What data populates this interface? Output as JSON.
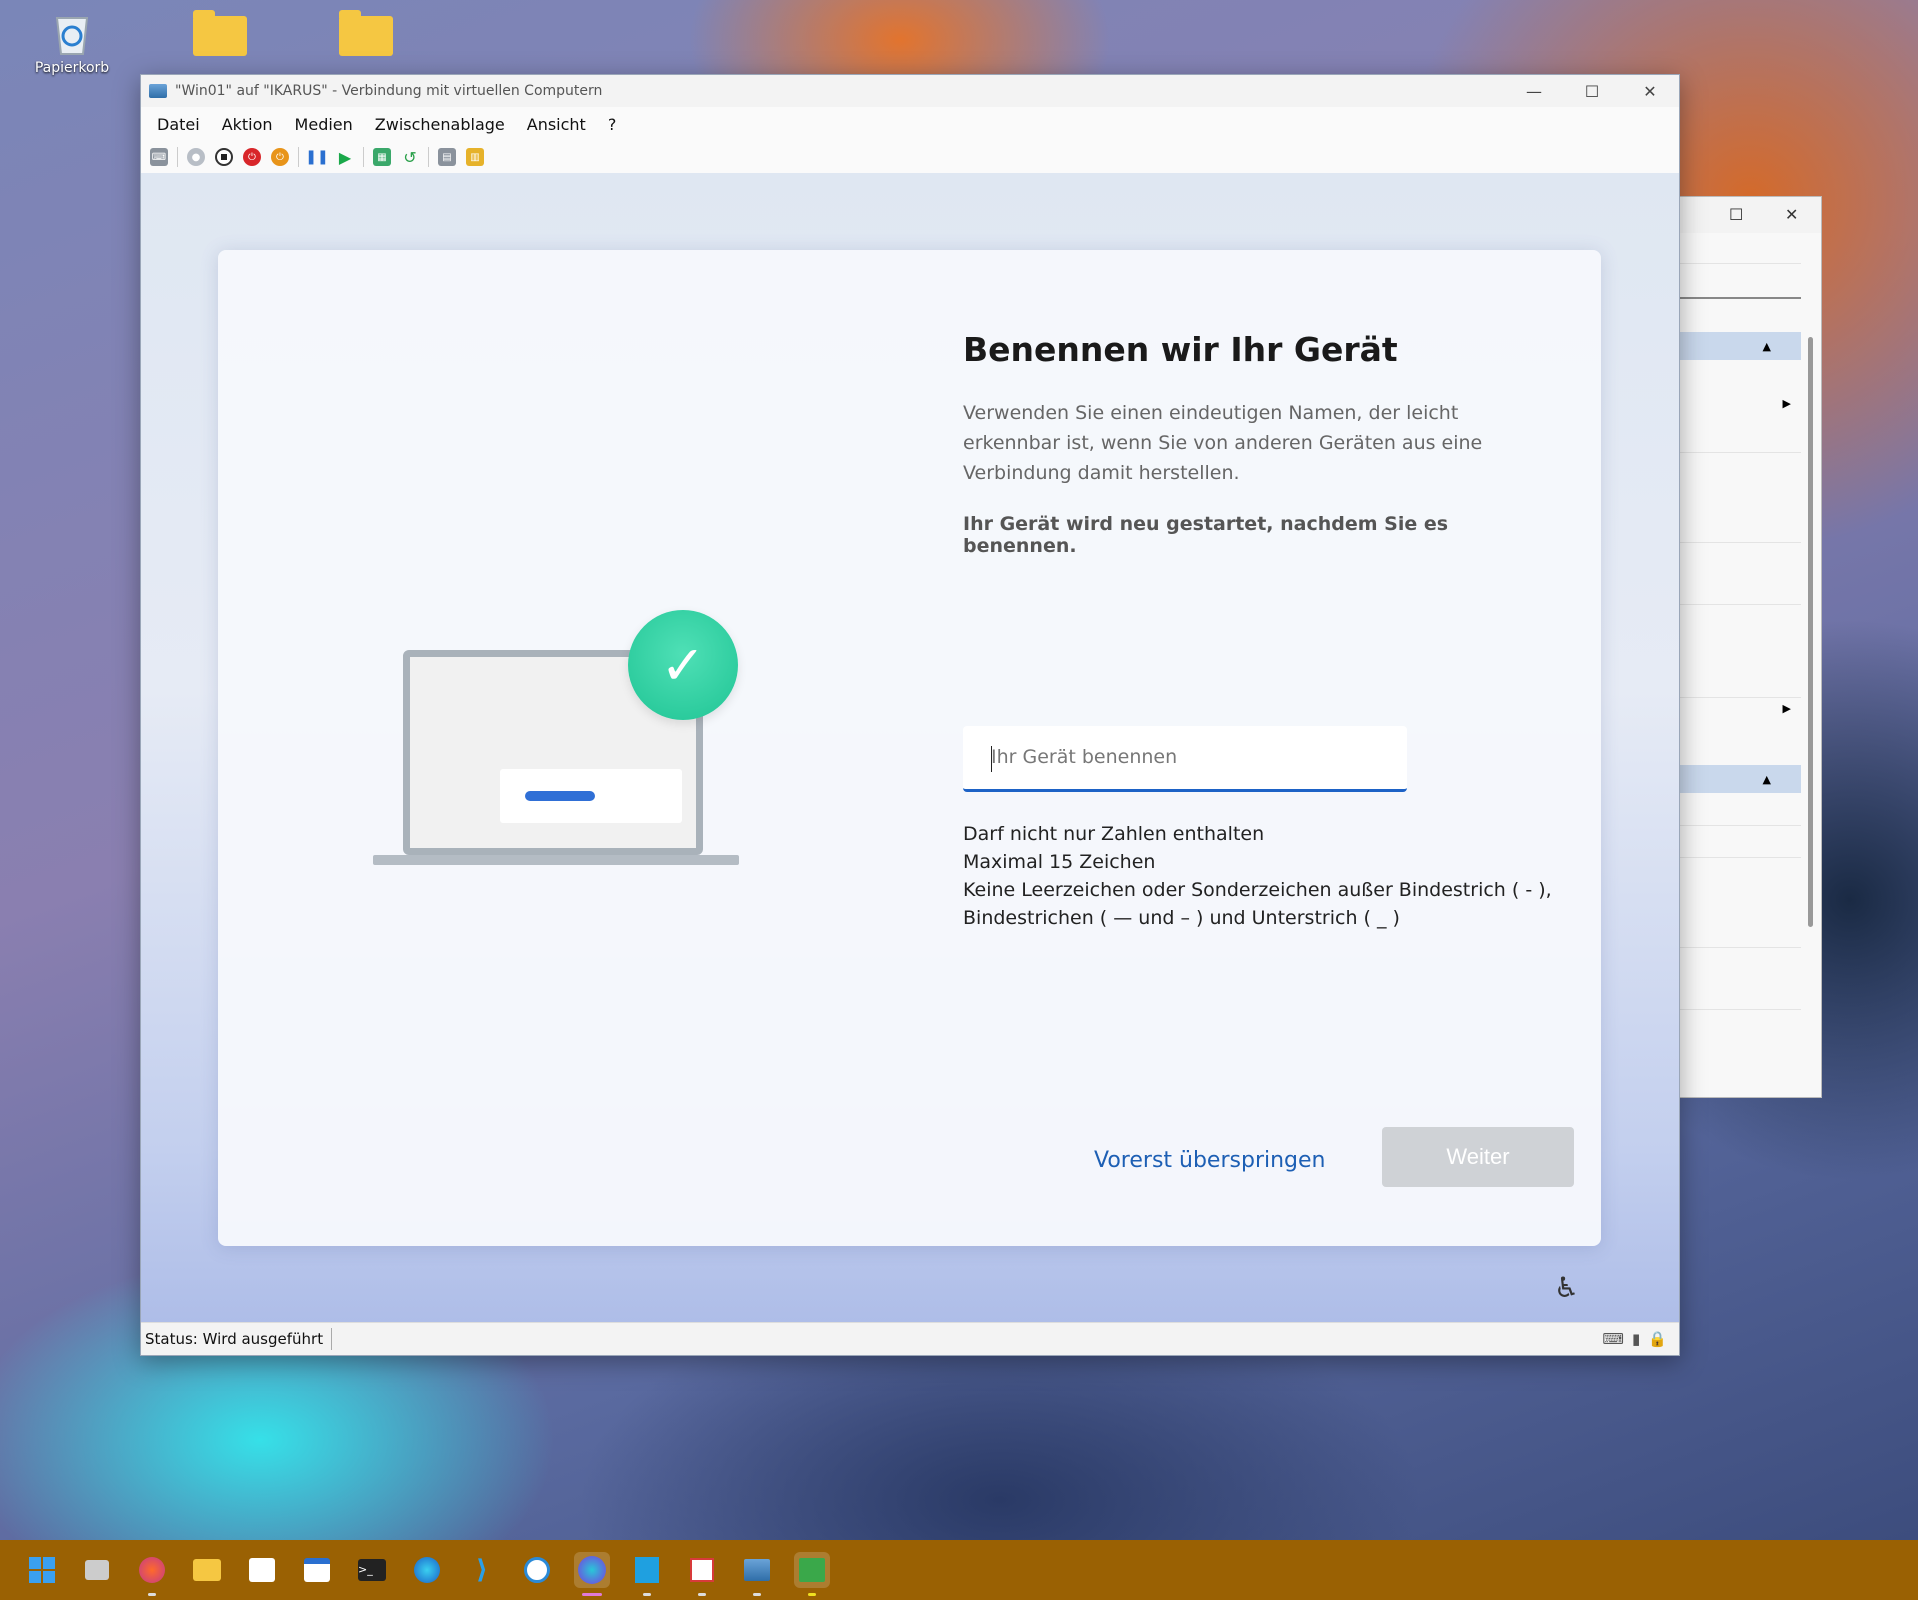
{
  "desktop": {
    "icons": [
      {
        "label": "Papierkorb",
        "icon": "recycle-bin-icon"
      },
      {
        "label": "",
        "icon": "folder-network-icon"
      },
      {
        "label": "",
        "icon": "folder-icon"
      }
    ]
  },
  "vm_window": {
    "title": "\"Win01\" auf \"IKARUS\" - Verbindung mit virtuellen Computern",
    "controls": {
      "minimize": "—",
      "maximize": "☐",
      "close": "✕"
    },
    "menu": [
      "Datei",
      "Aktion",
      "Medien",
      "Zwischenablage",
      "Ansicht",
      "?"
    ],
    "toolbar": [
      "ctrl-alt-del-icon",
      "start-icon",
      "turn-off-icon",
      "shutdown-icon",
      "save-icon",
      "pause-icon",
      "resume-icon",
      "checkpoint-icon",
      "revert-icon",
      "enhanced-session-icon",
      "share-icon"
    ],
    "status": "Status: Wird ausgeführt"
  },
  "oobe": {
    "title": "Benennen wir Ihr Gerät",
    "description": "Verwenden Sie einen eindeutigen Namen, der leicht erkennbar ist, wenn Sie von anderen Geräten aus eine Verbindung damit herstellen.",
    "note": "Ihr Gerät wird neu gestartet, nachdem Sie es benennen.",
    "input_placeholder": "Ihr Gerät benennen",
    "input_value": "",
    "rules": [
      "Darf nicht nur Zahlen enthalten",
      "Maximal 15 Zeichen",
      "Keine Leerzeichen oder Sonderzeichen außer Bindestrich ( - ),",
      "Bindestrichen ( — und – ) und Unterstrich ( _ )"
    ],
    "skip_label": "Vorerst überspringen",
    "next_label": "Weiter"
  },
  "taskbar": [
    "start-icon",
    "task-view-icon",
    "firefox-icon",
    "file-explorer-icon",
    "store-icon",
    "calendar-icon",
    "terminal-icon",
    "edge-icon",
    "vscode-icon",
    "sync-icon",
    "canva-icon",
    "azure-icon",
    "snipping-icon",
    "hyperv-manager-icon",
    "vm-connect-icon"
  ],
  "colors": {
    "accent": "#1d62c6",
    "taskbar": "#9a6103",
    "check": "#1fc494"
  }
}
